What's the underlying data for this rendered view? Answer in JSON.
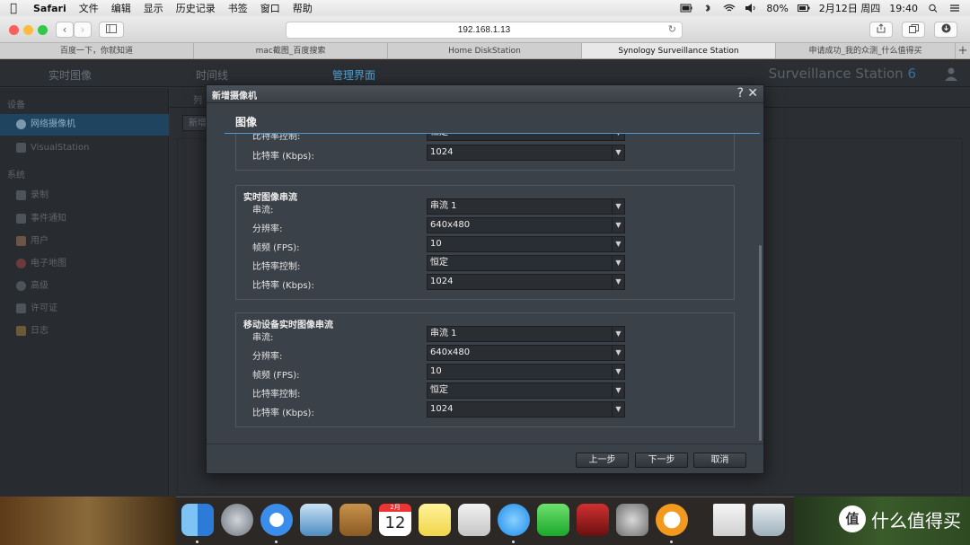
{
  "menubar": {
    "app_name": "Safari",
    "items": [
      "文件",
      "编辑",
      "显示",
      "历史记录",
      "书签",
      "窗口",
      "帮助"
    ],
    "battery": "80%",
    "date": "2月12日 周四",
    "time": "19:40"
  },
  "browser": {
    "address": "192.168.1.13",
    "tabs": [
      "百度一下，你就知道",
      "mac截图_百度搜索",
      "Home DiskStation",
      "Synology Surveillance Station",
      "申请成功_我的众测_什么值得买"
    ],
    "new_tab": "+"
  },
  "app": {
    "tabs": [
      "实时图像",
      "时间线",
      "管理界面"
    ],
    "logo": "Surveillance Station",
    "logo_version": "6",
    "sidebar": {
      "section_device": "设备",
      "device_items": [
        "网络摄像机",
        "VisualStation"
      ],
      "section_system": "系统",
      "system_items": [
        "录制",
        "事件通知",
        "用户",
        "电子地图",
        "高级",
        "许可证",
        "日志"
      ]
    },
    "content_sub_label": "列",
    "content_button": "新增"
  },
  "dialog": {
    "title": "新增摄像机",
    "help": "?",
    "close": "✕",
    "section": "图像",
    "partial_rows": [
      {
        "label": "比特率控制:",
        "value": "恒定"
      },
      {
        "label": "比特率 (Kbps):",
        "value": "1024"
      }
    ],
    "groups": [
      {
        "title": "实时图像串流",
        "rows": [
          {
            "label": "串流:",
            "value": "串流 1"
          },
          {
            "label": "分辨率:",
            "value": "640x480"
          },
          {
            "label": "帧频 (FPS):",
            "value": "10"
          },
          {
            "label": "比特率控制:",
            "value": "恒定"
          },
          {
            "label": "比特率 (Kbps):",
            "value": "1024"
          }
        ]
      },
      {
        "title": "移动设备实时图像串流",
        "rows": [
          {
            "label": "串流:",
            "value": "串流 1"
          },
          {
            "label": "分辨率:",
            "value": "640x480"
          },
          {
            "label": "帧频 (FPS):",
            "value": "10"
          },
          {
            "label": "比特率控制:",
            "value": "恒定"
          },
          {
            "label": "比特率 (Kbps):",
            "value": "1024"
          }
        ]
      }
    ],
    "buttons": {
      "prev": "上一步",
      "next": "下一步",
      "cancel": "取消"
    }
  },
  "dock": {
    "calendar_month": "2月",
    "calendar_day": "12"
  },
  "watermark": {
    "badge": "值",
    "text": "什么值得买"
  }
}
